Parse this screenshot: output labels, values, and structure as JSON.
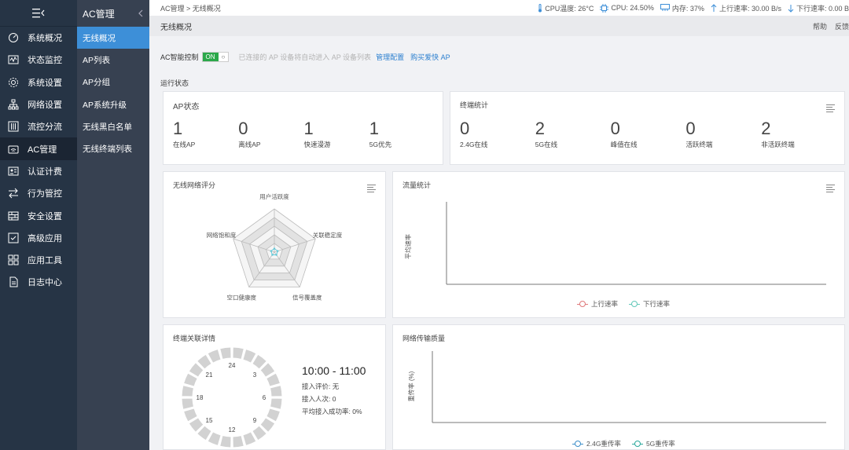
{
  "nav": {
    "collapse_icon": "menu-collapse-icon",
    "items": [
      {
        "label": "系统概况",
        "icon": "dashboard-icon"
      },
      {
        "label": "状态监控",
        "icon": "monitor-icon"
      },
      {
        "label": "系统设置",
        "icon": "gear-icon"
      },
      {
        "label": "网络设置",
        "icon": "network-icon"
      },
      {
        "label": "流控分流",
        "icon": "sliders-icon"
      },
      {
        "label": "AC管理",
        "icon": "wifi-icon"
      },
      {
        "label": "认证计费",
        "icon": "id-card-icon"
      },
      {
        "label": "行为管控",
        "icon": "arrows-icon"
      },
      {
        "label": "安全设置",
        "icon": "firewall-icon"
      },
      {
        "label": "高级应用",
        "icon": "check-box-icon"
      },
      {
        "label": "应用工具",
        "icon": "apps-icon"
      },
      {
        "label": "日志中心",
        "icon": "document-icon"
      }
    ],
    "active_index": 5
  },
  "subnav": {
    "title": "AC管理",
    "items": [
      "无线概况",
      "AP列表",
      "AP分组",
      "AP系统升级",
      "无线黑白名单",
      "无线终端列表"
    ],
    "active_index": 0
  },
  "topbar": {
    "breadcrumb": "AC管理 > 无线概况",
    "cpu_temp": "CPU温度: 26°C",
    "cpu": "CPU: 24.50%",
    "memory": "内存: 37%",
    "up_rate": "上行速率: 30.00 B/s",
    "down_rate": "下行速率: 0.00 B"
  },
  "titlebar": {
    "title": "无线概况",
    "help": "帮助",
    "feedback": "反馈"
  },
  "ac_control": {
    "label": "AC智能控制",
    "on": "ON",
    "hint": "已连接的 AP 设备将自动进入 AP 设备列表",
    "manage": "管理配置",
    "buy": "购买爱快 AP"
  },
  "section_label": "运行状态",
  "ap_status": {
    "title": "AP状态",
    "stats": [
      {
        "value": "1",
        "label": "在线AP"
      },
      {
        "value": "0",
        "label": "离线AP"
      },
      {
        "value": "1",
        "label": "快速漫游"
      },
      {
        "value": "1",
        "label": "5G优先"
      }
    ]
  },
  "terminal_stats": {
    "title": "终端统计",
    "stats": [
      {
        "value": "0",
        "label": "2.4G在线"
      },
      {
        "value": "2",
        "label": "5G在线"
      },
      {
        "value": "0",
        "label": "峰值在线"
      },
      {
        "value": "0",
        "label": "活跃终端"
      },
      {
        "value": "2",
        "label": "非活跃终端"
      }
    ]
  },
  "score": {
    "title": "无线网络评分",
    "axes": [
      "用户活跃度",
      "关联稳定度",
      "信号覆盖度",
      "空口健康度",
      "网络饱和度"
    ],
    "values": [
      0.08,
      0.08,
      0.08,
      0.08,
      0.08
    ],
    "color": "#5ec8d8"
  },
  "traffic": {
    "title": "流量统计",
    "ylabel": "平均速率",
    "legend": [
      {
        "label": "上行速率",
        "color": "#e0797b"
      },
      {
        "label": "下行速率",
        "color": "#62c8b9"
      }
    ]
  },
  "assoc": {
    "title": "终端关联详情",
    "clock_numbers": [
      "24",
      "3",
      "6",
      "9",
      "12",
      "15",
      "18",
      "21"
    ],
    "time": "10:00 - 11:00",
    "eval": "接入评价: 无",
    "count": "接入人次: 0",
    "success": "平均接入成功率: 0%"
  },
  "quality": {
    "title": "网络传输质量",
    "ylabel": "重传率 (%)",
    "legend": [
      {
        "label": "2.4G重传率",
        "color": "#3d8fc9"
      },
      {
        "label": "5G重传率",
        "color": "#2aa89c"
      }
    ]
  }
}
